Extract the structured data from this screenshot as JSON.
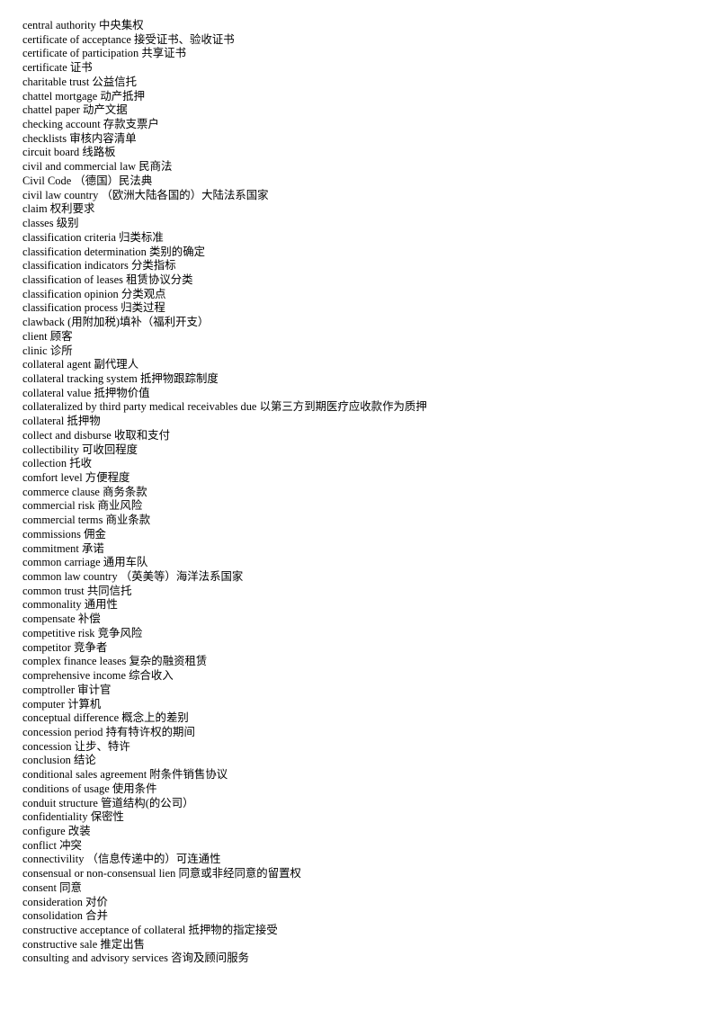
{
  "document": {
    "type": "bilingual-glossary",
    "section_letter": "C",
    "language_pair": "English - Chinese",
    "page_background": "#ffffff",
    "text_color": "#000000",
    "entries": [
      {
        "term": "central  authority",
        "translation": "中央集权"
      },
      {
        "term": "certificate  of acceptance",
        "translation": "接受证书、验收证书"
      },
      {
        "term": "certificate  of participation",
        "translation": "共享证书"
      },
      {
        "term": "certificate",
        "translation": "证书"
      },
      {
        "term": "charitable  trust",
        "translation": "公益信托"
      },
      {
        "term": "chattel mortgage",
        "translation": "动产抵押"
      },
      {
        "term": "chattel  paper",
        "translation": "动产文据"
      },
      {
        "term": "checking account",
        "translation": "存款支票户"
      },
      {
        "term": "checklists",
        "translation": "审核内容清单"
      },
      {
        "term": "circuit board",
        "translation": "线路板"
      },
      {
        "term": "civil and commercial  law",
        "translation": " 民商法"
      },
      {
        "term": "Civil Code",
        "translation": "（德国）民法典"
      },
      {
        "term": "civil law country",
        "translation": "（欧洲大陆各国的）大陆法系国家"
      },
      {
        "term": "claim",
        "translation": " 权利要求"
      },
      {
        "term": "classes",
        "translation": "级别"
      },
      {
        "term": "classification  criteria",
        "translation": "归类标准"
      },
      {
        "term": "classification  determination",
        "translation": "类别的确定"
      },
      {
        "term": "classification  indicators",
        "translation": "分类指标"
      },
      {
        "term": "classification  of leases",
        "translation": "租赁协议分类"
      },
      {
        "term": "classification  opinion",
        "translation": " 分类观点"
      },
      {
        "term": "classification  process",
        "translation": "归类过程"
      },
      {
        "term": "clawback",
        "translation": "(用附加税)填补（福利开支）"
      },
      {
        "term": "client",
        "translation": "顾客"
      },
      {
        "term": "clinic",
        "translation": "诊所"
      },
      {
        "term": "collateral  agent",
        "translation": "副代理人"
      },
      {
        "term": "collateral  tracking  system",
        "translation": "抵押物跟踪制度"
      },
      {
        "term": "collateral  value",
        "translation": "抵押物价值"
      },
      {
        "term": "collateralized  by third party medical  receivables  due",
        "translation": "以第三方到期医疗应收款作为质押"
      },
      {
        "term": "collateral",
        "translation": "抵押物"
      },
      {
        "term": "collect and disburse",
        "translation": "收取和支付"
      },
      {
        "term": "collectibility",
        "translation": "可收回程度"
      },
      {
        "term": "collection",
        "translation": "托收"
      },
      {
        "term": "comfort level",
        "translation": "方便程度"
      },
      {
        "term": "commerce  clause",
        "translation": "商务条款"
      },
      {
        "term": "commercial  risk",
        "translation": "商业风险"
      },
      {
        "term": "commercial  terms",
        "translation": "商业条款"
      },
      {
        "term": "commissions",
        "translation": "佣金"
      },
      {
        "term": "commitment",
        "translation": "承诺"
      },
      {
        "term": "common  carriage",
        "translation": "通用车队"
      },
      {
        "term": "common law country",
        "translation": "（英美等）海洋法系国家"
      },
      {
        "term": "common  trust",
        "translation": "共同信托"
      },
      {
        "term": "commonality",
        "translation": "通用性"
      },
      {
        "term": "compensate",
        "translation": "补偿"
      },
      {
        "term": "competitive  risk",
        "translation": "竞争风险"
      },
      {
        "term": "competitor",
        "translation": "竞争者"
      },
      {
        "term": "complex  finance  leases",
        "translation": "复杂的融资租赁"
      },
      {
        "term": "comprehensive  income",
        "translation": "综合收入"
      },
      {
        "term": "comptroller",
        "translation": "审计官"
      },
      {
        "term": "computer",
        "translation": "计算机"
      },
      {
        "term": "conceptual  difference",
        "translation": "概念上的差别"
      },
      {
        "term": "concession period",
        "translation": "持有特许权的期间"
      },
      {
        "term": "concession",
        "translation": "让步、特许"
      },
      {
        "term": "conclusion",
        "translation": "结论"
      },
      {
        "term": "conditional  sales agreement",
        "translation": "附条件销售协议"
      },
      {
        "term": "conditions of usage",
        "translation": "使用条件"
      },
      {
        "term": "conduit structure",
        "translation": "管道结构(的公司）"
      },
      {
        "term": "confidentiality",
        "translation": "保密性"
      },
      {
        "term": "configure",
        "translation": "改装"
      },
      {
        "term": "conflict",
        "translation": "冲突"
      },
      {
        "term": "connectivility",
        "translation": "（信息传递中的）可连通性"
      },
      {
        "term": "consensual or non-consensual lien",
        "translation": "同意或非经同意的留置权"
      },
      {
        "term": "consent",
        "translation": " 同意"
      },
      {
        "term": "consideration",
        "translation": "对价"
      },
      {
        "term": "consolidation",
        "translation": "合并"
      },
      {
        "term": "constructive  acceptance  of collateral",
        "translation": "抵押物的指定接受"
      },
      {
        "term": "constructive  sale",
        "translation": "推定出售"
      },
      {
        "term": "consulting  and advisory services",
        "translation": "咨询及顾问服务"
      }
    ]
  }
}
